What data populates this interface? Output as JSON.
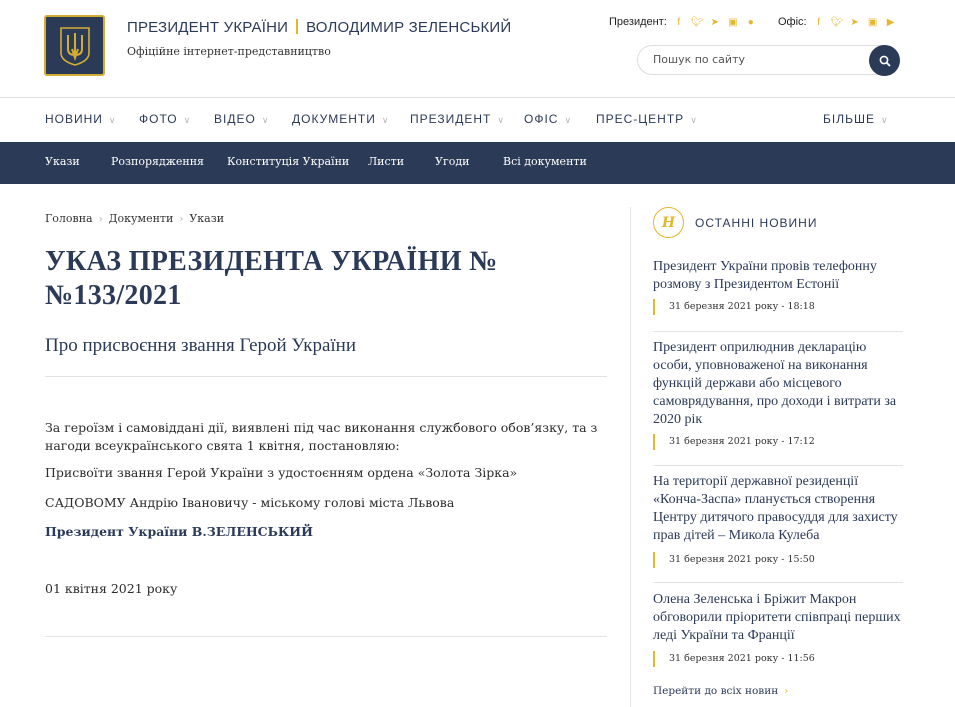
{
  "header": {
    "title_left": "ПРЕЗИДЕНТ УКРАЇНИ",
    "title_right": "ВОЛОДИМИР ЗЕЛЕНСЬКИЙ",
    "subtitle": "Офіційне інтернет-представництво",
    "social_president_label": "Президент:",
    "social_office_label": "Офіс:",
    "social_icons": [
      "facebook-icon",
      "twitter-icon",
      "telegram-icon",
      "instagram-icon",
      "flickr-icon"
    ],
    "social_office_icons": [
      "facebook-icon",
      "twitter-icon",
      "telegram-icon",
      "instagram-icon",
      "youtube-icon"
    ],
    "search_placeholder": "Пошук по сайту"
  },
  "mainnav": {
    "items": [
      "НОВИНИ",
      "ФОТО",
      "ВІДЕО",
      "ДОКУМЕНТИ",
      "ПРЕЗИДЕНТ",
      "ОФІС",
      "ПРЕС-ЦЕНТР"
    ],
    "more": "БІЛЬШЕ"
  },
  "subnav": {
    "items": [
      "Укази",
      "Розпорядження",
      "Конституція України",
      "Листи",
      "Угоди",
      "Всі документи"
    ]
  },
  "breadcrumb": [
    "Головна",
    "Документи",
    "Укази"
  ],
  "main": {
    "title": "УКАЗ ПРЕЗИДЕНТА УКРАЇНИ № №133/2021",
    "subtitle": "Про присвоєння звання Герой України",
    "paragraphs": [
      "За героїзм і самовіддані дії, виявлені під час виконання службового обов’язку, та з нагоди всеукраїнського свята 1 квітня, постановляю:",
      "Присвоїти звання Герой України з удостоєнням ордена «Золота Зірка»",
      "САДОВОМУ Андрію Івановичу - міському голові міста Львова"
    ],
    "signature": "Президент України В.ЗЕЛЕНСЬКИЙ",
    "date": "01 квітня 2021 року"
  },
  "sidebar": {
    "icon_letter": "Н",
    "heading": "ОСТАННІ НОВИНИ",
    "news": [
      {
        "title": "Президент України провів телефонну розмову з Президентом Естонії",
        "date": "31 березня 2021 року - 18:18"
      },
      {
        "title": "Президент оприлюднив декларацію особи, уповноваженої на виконання функцій держави або місцевого самоврядування, про доходи і витрати за 2020 рік",
        "date": "31 березня 2021 року - 17:12"
      },
      {
        "title": "На території державної резиденції «Конча-Заспа» планується створення Центру дитячого правосуддя для захисту прав дітей – Микола Кулеба",
        "date": "31 березня 2021 року - 15:50"
      },
      {
        "title": "Олена Зеленська і Бріжит Макрон обговорили пріоритети співпраці перших леді України та Франції",
        "date": "31 березня 2021 року - 11:56"
      }
    ],
    "all_news": "Перейти до всіх новин"
  },
  "colors": {
    "navy": "#2b3a57",
    "gold": "#e5b72d"
  }
}
